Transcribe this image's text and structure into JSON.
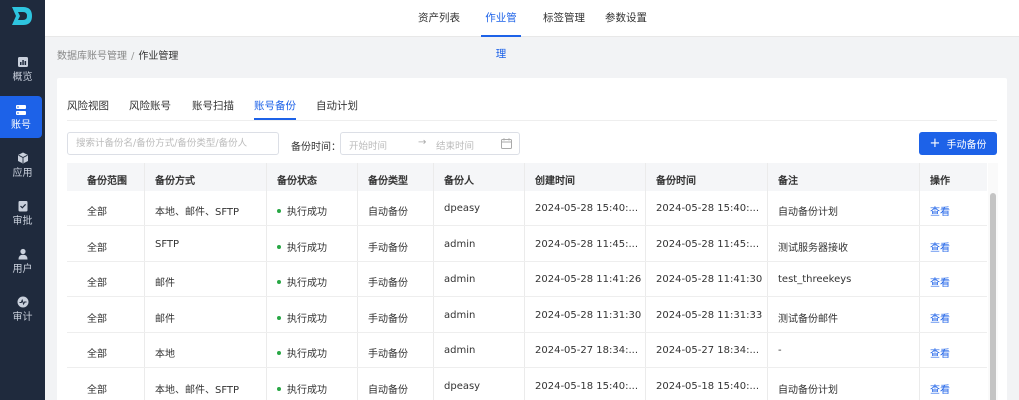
{
  "sidebar": {
    "items": [
      {
        "label": "概览",
        "icon": "chart-icon"
      },
      {
        "label": "账号",
        "icon": "server-icon",
        "active": true
      },
      {
        "label": "应用",
        "icon": "cube-icon"
      },
      {
        "label": "审批",
        "icon": "check-doc-icon"
      },
      {
        "label": "用户",
        "icon": "user-icon"
      },
      {
        "label": "审计",
        "icon": "pulse-icon"
      }
    ]
  },
  "topnav": {
    "tabs": [
      "资产列表",
      "作业管理",
      "标签管理",
      "参数设置"
    ],
    "active": "作业管理"
  },
  "breadcrumb": {
    "parent": "数据库账号管理",
    "separator": "/",
    "current": "作业管理"
  },
  "subtabs": {
    "items": [
      "风险视图",
      "风险账号",
      "账号扫描",
      "账号备份",
      "自动计划"
    ],
    "active": "账号备份"
  },
  "filters": {
    "search_placeholder": "搜索计备份名/备份方式/备份类型/备份人",
    "time_label": "备份时间：",
    "start_placeholder": "开始时间",
    "end_placeholder": "结束时间",
    "arrow": "→"
  },
  "actions": {
    "manual_backup": "手动备份",
    "plus": "+"
  },
  "table": {
    "headers": [
      "备份范围",
      "备份方式",
      "备份状态",
      "备份类型",
      "备份人",
      "创建时间",
      "备份时间",
      "备注",
      "操作"
    ],
    "rows": [
      [
        "全部",
        "本地、邮件、SFTP",
        "执行成功",
        "自动备份",
        "dpeasy",
        "2024-05-28 15:40:...",
        "2024-05-28 15:40:...",
        "自动备份计划",
        "查看"
      ],
      [
        "全部",
        "SFTP",
        "执行成功",
        "手动备份",
        "admin",
        "2024-05-28 11:45:...",
        "2024-05-28 11:45:...",
        "测试服务器接收",
        "查看"
      ],
      [
        "全部",
        "邮件",
        "执行成功",
        "手动备份",
        "admin",
        "2024-05-28 11:41:26",
        "2024-05-28 11:41:30",
        "test_threekeys",
        "查看"
      ],
      [
        "全部",
        "邮件",
        "执行成功",
        "手动备份",
        "admin",
        "2024-05-28 11:31:30",
        "2024-05-28 11:31:33",
        "测试备份邮件",
        "查看"
      ],
      [
        "全部",
        "本地",
        "执行成功",
        "手动备份",
        "admin",
        "2024-05-27 18:34:...",
        "2024-05-27 18:34:...",
        "-",
        "查看"
      ],
      [
        "全部",
        "本地、邮件、SFTP",
        "执行成功",
        "自动备份",
        "dpeasy",
        "2024-05-18 15:40:...",
        "2024-05-18 15:40:...",
        "自动备份计划",
        "查看"
      ]
    ]
  },
  "colors": {
    "accent": "#1d62e8",
    "sidebar_bg": "#1f2a3d",
    "success": "#28a745"
  }
}
